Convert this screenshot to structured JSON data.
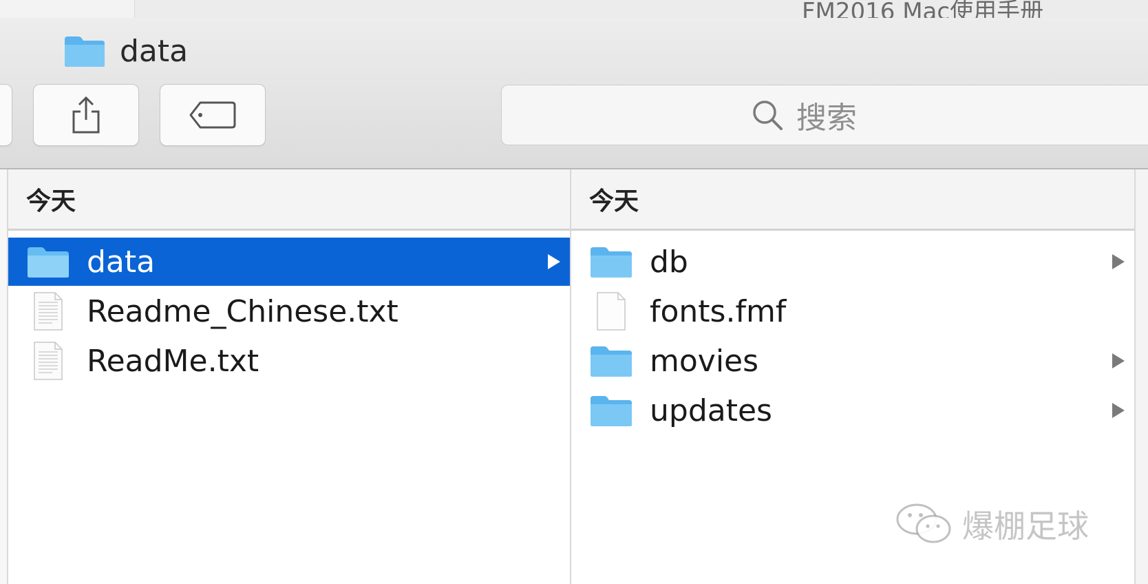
{
  "background_window": {
    "title": "FM2016 Mac使用手册"
  },
  "window": {
    "title": "data",
    "title_icon": "folder-icon"
  },
  "toolbar": {
    "buttons": [
      {
        "name": "share",
        "icon": "share-icon"
      },
      {
        "name": "tag",
        "icon": "tag-icon"
      }
    ],
    "search": {
      "placeholder": "搜索",
      "icon": "search-icon"
    }
  },
  "columns": [
    {
      "header": "今天",
      "items": [
        {
          "name": "data",
          "type": "folder",
          "selected": true,
          "has_children": true
        },
        {
          "name": "Readme_Chinese.txt",
          "type": "text-file",
          "selected": false,
          "has_children": false
        },
        {
          "name": "ReadMe.txt",
          "type": "text-file",
          "selected": false,
          "has_children": false
        }
      ]
    },
    {
      "header": "今天",
      "items": [
        {
          "name": "db",
          "type": "folder",
          "selected": false,
          "has_children": true
        },
        {
          "name": "fonts.fmf",
          "type": "blank-file",
          "selected": false,
          "has_children": false
        },
        {
          "name": "movies",
          "type": "folder",
          "selected": false,
          "has_children": true
        },
        {
          "name": "updates",
          "type": "folder",
          "selected": false,
          "has_children": true
        }
      ]
    }
  ],
  "watermark": {
    "text": "爆棚足球",
    "icon": "wechat-icon"
  },
  "colors": {
    "selection": "#0a64d6",
    "folder": "#5fb8f0",
    "toolbar_bg": "#e4e4e4"
  }
}
